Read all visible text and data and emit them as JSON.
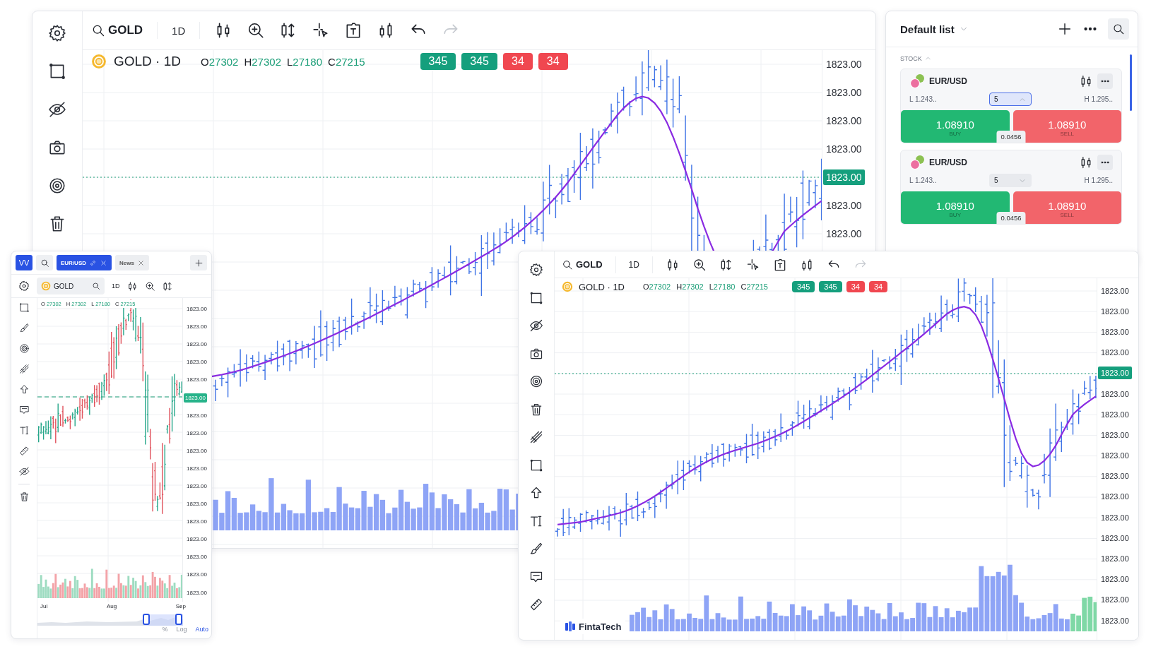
{
  "main_window": {
    "toolbar": {
      "symbol": "GOLD",
      "interval": "1D"
    },
    "legend": {
      "title": "GOLD · 1D",
      "ohlc": [
        {
          "label": "O",
          "value": "27302"
        },
        {
          "label": "H",
          "value": "27302"
        },
        {
          "label": "L",
          "value": "27180"
        },
        {
          "label": "C",
          "value": "27215"
        }
      ],
      "badges": [
        {
          "text": "345",
          "color": "#159f7d"
        },
        {
          "text": "345",
          "color": "#159f7d"
        },
        {
          "text": "34",
          "color": "#f04750"
        },
        {
          "text": "34",
          "color": "#f04750"
        }
      ]
    },
    "price_axis": [
      {
        "kind": "tick",
        "text": "1823.00"
      },
      {
        "kind": "tick",
        "text": "1823.00"
      },
      {
        "kind": "tick",
        "text": "1823.00"
      },
      {
        "kind": "tick",
        "text": "1823.00"
      },
      {
        "kind": "current",
        "text": "1823.00"
      },
      {
        "kind": "tick",
        "text": "1823.00"
      },
      {
        "kind": "tick",
        "text": "1823.00"
      }
    ]
  },
  "watchlist": {
    "title": "Default list",
    "section": "STOCK",
    "section_expanded": true,
    "items": [
      {
        "symbol": "EUR/USD",
        "low": "L 1.243..",
        "quantity": "5",
        "expanded": true,
        "high": "H 1.295..",
        "buy": {
          "price": "1.08910",
          "label": "BUY"
        },
        "sell": {
          "price": "1.08910",
          "label": "SELL"
        },
        "spread": "0.0456"
      },
      {
        "symbol": "EUR/USD",
        "low": "L 1.243..",
        "quantity": "5",
        "expanded": false,
        "high": "H 1.295..",
        "buy": {
          "price": "1.08910",
          "label": "BUY"
        },
        "sell": {
          "price": "1.08910",
          "label": "SELL"
        },
        "spread": "0.0456"
      }
    ]
  },
  "mini_window": {
    "logo": "VV",
    "tabs": [
      {
        "label": "EUR/USD",
        "selected": true
      },
      {
        "label": "News",
        "selected": false
      }
    ],
    "toolbar": {
      "symbol": "GOLD",
      "interval": "1D"
    },
    "ohlc": [
      {
        "label": "O",
        "value": "27302"
      },
      {
        "label": "H",
        "value": "27302"
      },
      {
        "label": "L",
        "value": "27180"
      },
      {
        "label": "C",
        "value": "27215"
      }
    ],
    "price_axis": [
      {
        "kind": "tick",
        "text": "1823.00"
      },
      {
        "kind": "tick",
        "text": "1823.00"
      },
      {
        "kind": "tick",
        "text": "1823.00"
      },
      {
        "kind": "tick",
        "text": "1823.00"
      },
      {
        "kind": "tick",
        "text": "1823.00"
      },
      {
        "kind": "current",
        "text": "1823.00"
      },
      {
        "kind": "tick",
        "text": "1823.00"
      },
      {
        "kind": "tick",
        "text": "1823.00"
      },
      {
        "kind": "tick",
        "text": "1823.00"
      },
      {
        "kind": "tick",
        "text": "1823.00"
      },
      {
        "kind": "tick",
        "text": "1823.00"
      },
      {
        "kind": "tick",
        "text": "1823.00"
      },
      {
        "kind": "tick",
        "text": "1823.00"
      },
      {
        "kind": "tick",
        "text": "1823.00"
      },
      {
        "kind": "tick",
        "text": "1823.00"
      },
      {
        "kind": "tick",
        "text": "1823.00"
      },
      {
        "kind": "tick",
        "text": "1823.00"
      }
    ],
    "months": [
      "Jul",
      "Aug",
      "Sep"
    ],
    "scale_options": [
      {
        "label": "%",
        "selected": false
      },
      {
        "label": "Log",
        "selected": false
      },
      {
        "label": "Auto",
        "selected": true
      }
    ]
  },
  "detail_window": {
    "toolbar": {
      "symbol": "GOLD",
      "interval": "1D"
    },
    "legend": {
      "title": "GOLD · 1D",
      "ohlc": [
        {
          "label": "O",
          "value": "27302"
        },
        {
          "label": "H",
          "value": "27302"
        },
        {
          "label": "L",
          "value": "27180"
        },
        {
          "label": "C",
          "value": "27215"
        }
      ],
      "badges": [
        {
          "text": "345",
          "color": "#159f7d"
        },
        {
          "text": "345",
          "color": "#159f7d"
        },
        {
          "text": "34",
          "color": "#f04750"
        },
        {
          "text": "34",
          "color": "#f04750"
        }
      ]
    },
    "price_axis": [
      {
        "kind": "tick",
        "text": "1823.00"
      },
      {
        "kind": "tick",
        "text": "1823.00"
      },
      {
        "kind": "tick",
        "text": "1823.00"
      },
      {
        "kind": "tick",
        "text": "1823.00"
      },
      {
        "kind": "current",
        "text": "1823.00"
      },
      {
        "kind": "tick",
        "text": "1823.00"
      },
      {
        "kind": "tick",
        "text": "1823.00"
      },
      {
        "kind": "tick",
        "text": "1823.00"
      },
      {
        "kind": "tick",
        "text": "1823.00"
      },
      {
        "kind": "tick",
        "text": "1823.00"
      },
      {
        "kind": "tick",
        "text": "1823.00"
      },
      {
        "kind": "tick",
        "text": "1823.00"
      },
      {
        "kind": "tick",
        "text": "1823.00"
      },
      {
        "kind": "tick",
        "text": "1823.00"
      },
      {
        "kind": "tick",
        "text": "1823.00"
      },
      {
        "kind": "tick",
        "text": "1823.00"
      },
      {
        "kind": "tick",
        "text": "1823.00"
      }
    ],
    "brand": "FintaTech"
  }
}
